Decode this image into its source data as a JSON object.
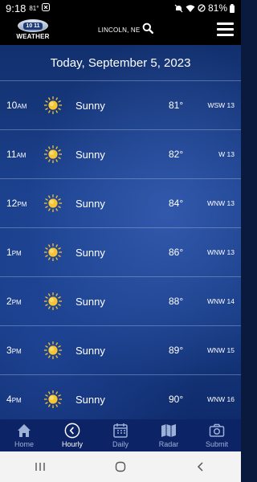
{
  "status_bar": {
    "time": "9:18",
    "temp": "81°",
    "battery": "81%"
  },
  "header": {
    "logo_number": "10 11",
    "logo_word": "WEATHER",
    "location": "LINCOLN, NE"
  },
  "main": {
    "date_title": "Today, September 5, 2023",
    "hours": [
      {
        "hour": "10",
        "period": "AM",
        "condition": "Sunny",
        "temp": "81°",
        "wind": "WSW 13",
        "icon": "sun-icon"
      },
      {
        "hour": "11",
        "period": "AM",
        "condition": "Sunny",
        "temp": "82°",
        "wind": "W 13",
        "icon": "sun-icon"
      },
      {
        "hour": "12",
        "period": "PM",
        "condition": "Sunny",
        "temp": "84°",
        "wind": "WNW 13",
        "icon": "sun-icon"
      },
      {
        "hour": "1",
        "period": "PM",
        "condition": "Sunny",
        "temp": "86°",
        "wind": "WNW 13",
        "icon": "sun-icon"
      },
      {
        "hour": "2",
        "period": "PM",
        "condition": "Sunny",
        "temp": "88°",
        "wind": "WNW 14",
        "icon": "sun-icon"
      },
      {
        "hour": "3",
        "period": "PM",
        "condition": "Sunny",
        "temp": "89°",
        "wind": "WNW 15",
        "icon": "sun-icon"
      },
      {
        "hour": "4",
        "period": "PM",
        "condition": "Sunny",
        "temp": "90°",
        "wind": "WNW 16",
        "icon": "sun-icon"
      }
    ]
  },
  "tabs": [
    {
      "label": "Home",
      "icon": "home-icon",
      "active": false
    },
    {
      "label": "Hourly",
      "icon": "clock-icon",
      "active": true
    },
    {
      "label": "Daily",
      "icon": "calendar-icon",
      "active": false
    },
    {
      "label": "Radar",
      "icon": "map-icon",
      "active": false
    },
    {
      "label": "Submit",
      "icon": "camera-icon",
      "active": false
    }
  ],
  "colors": {
    "accent": "#ffffff",
    "tab_bar": "#0c2466",
    "inactive_tab": "#9db0d8",
    "sun": "#f7c531"
  }
}
